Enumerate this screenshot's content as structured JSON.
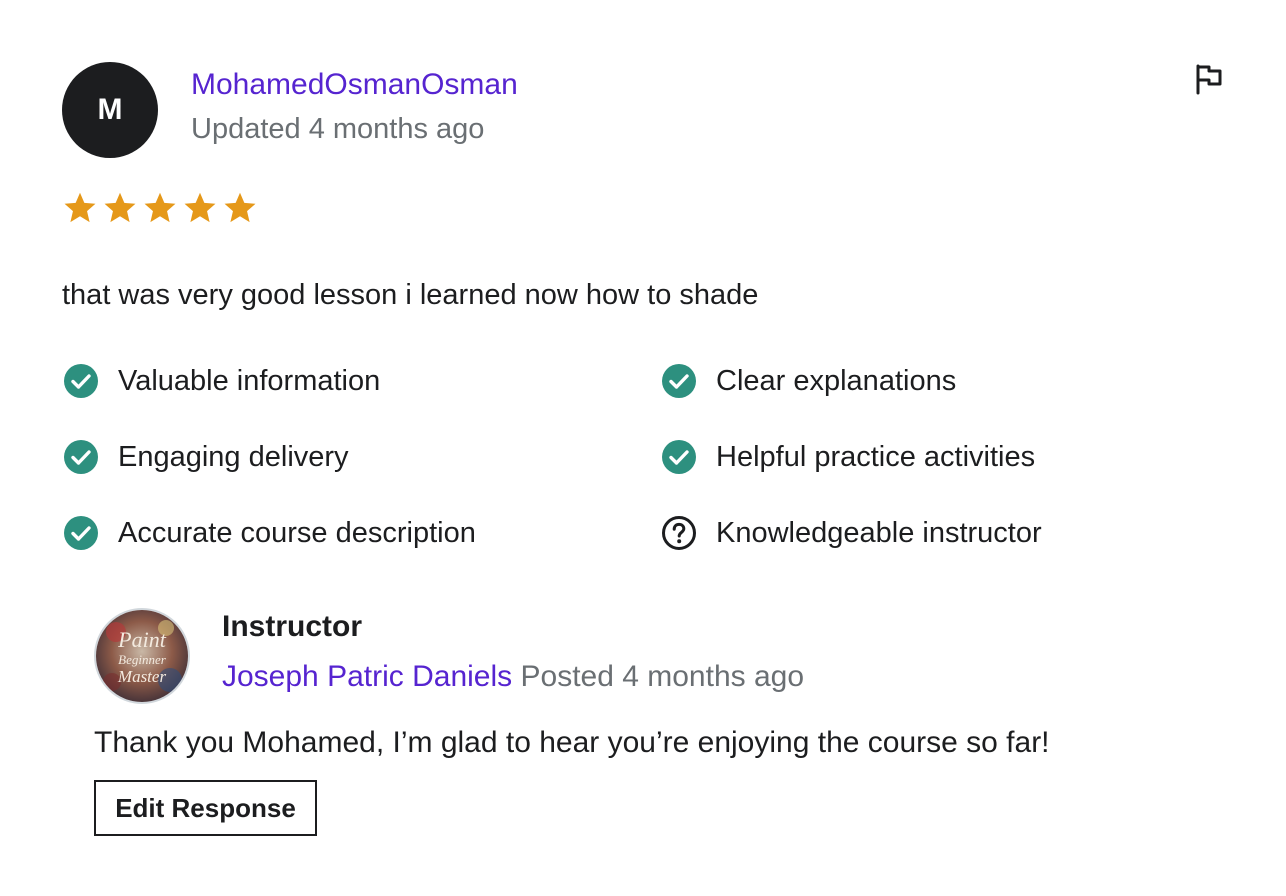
{
  "review": {
    "avatar_initial": "M",
    "reviewer_name": "MohamedOsmanOsman",
    "updated": "Updated 4 months ago",
    "flag_icon": "flag-icon",
    "rating": 5,
    "rating_max": 5,
    "star_color": "#e59819",
    "comment": "that was very good lesson i learned now how to shade",
    "criteria": [
      {
        "label": "Valuable information",
        "status": "yes"
      },
      {
        "label": "Clear explanations",
        "status": "yes"
      },
      {
        "label": "Engaging delivery",
        "status": "yes"
      },
      {
        "label": "Helpful practice activities",
        "status": "yes"
      },
      {
        "label": "Accurate course description",
        "status": "yes"
      },
      {
        "label": "Knowledgeable instructor",
        "status": "unsure"
      }
    ],
    "check_color": "#2d907f"
  },
  "response": {
    "role": "Instructor",
    "instructor_name": "Joseph Patric Daniels",
    "posted": "Posted 4 months ago",
    "avatar_text": [
      "Paint",
      "Beginner",
      "Master"
    ],
    "reply": "Thank you Mohamed, I’m glad to hear you’re enjoying the course so far!",
    "edit_button": "Edit Response"
  },
  "colors": {
    "link": "#5624d0",
    "muted": "#6a6f73",
    "text": "#1c1d1f"
  }
}
